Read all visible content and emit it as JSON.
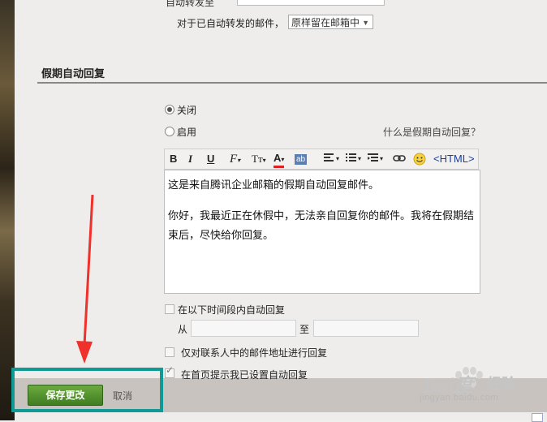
{
  "top": {
    "cut_label": "自动转发至",
    "forward_label": "对于已自动转发的邮件，",
    "forward_select": "原样留在邮箱中"
  },
  "section": {
    "title": "假期自动回复"
  },
  "options": {
    "off_label": "关闭",
    "on_label": "启用",
    "help_link": "什么是假期自动回复？",
    "selected": "off"
  },
  "toolbar": {
    "bold": "B",
    "italic": "I",
    "underline": "U",
    "font": "F",
    "size": "Tт",
    "color": "A",
    "bg": "ab",
    "html": "<HTML>"
  },
  "editor": {
    "line1": "这是来自腾讯企业邮箱的假期自动回复邮件。",
    "line2": "你好，我最近正在休假中，无法亲自回复你的邮件。我将在假期结束后，尽快给你回复。"
  },
  "schedule": {
    "label": "在以下时间段内自动回复",
    "from_label": "从",
    "to_label": "至"
  },
  "contacts_only": {
    "label": "仅对联系人中的邮件地址进行回复"
  },
  "homepage_notice": {
    "label": "在首页提示我已设置自动回复"
  },
  "actions": {
    "save": "保存更改",
    "cancel": "取消"
  },
  "watermark": {
    "brand": "Bai度",
    "suffix": "经验",
    "url": "jingyan.baidu.com"
  },
  "colors": {
    "save_green": "#4f8f2c",
    "highlight_teal": "#0f9a96",
    "arrow_red": "#f0302a"
  }
}
